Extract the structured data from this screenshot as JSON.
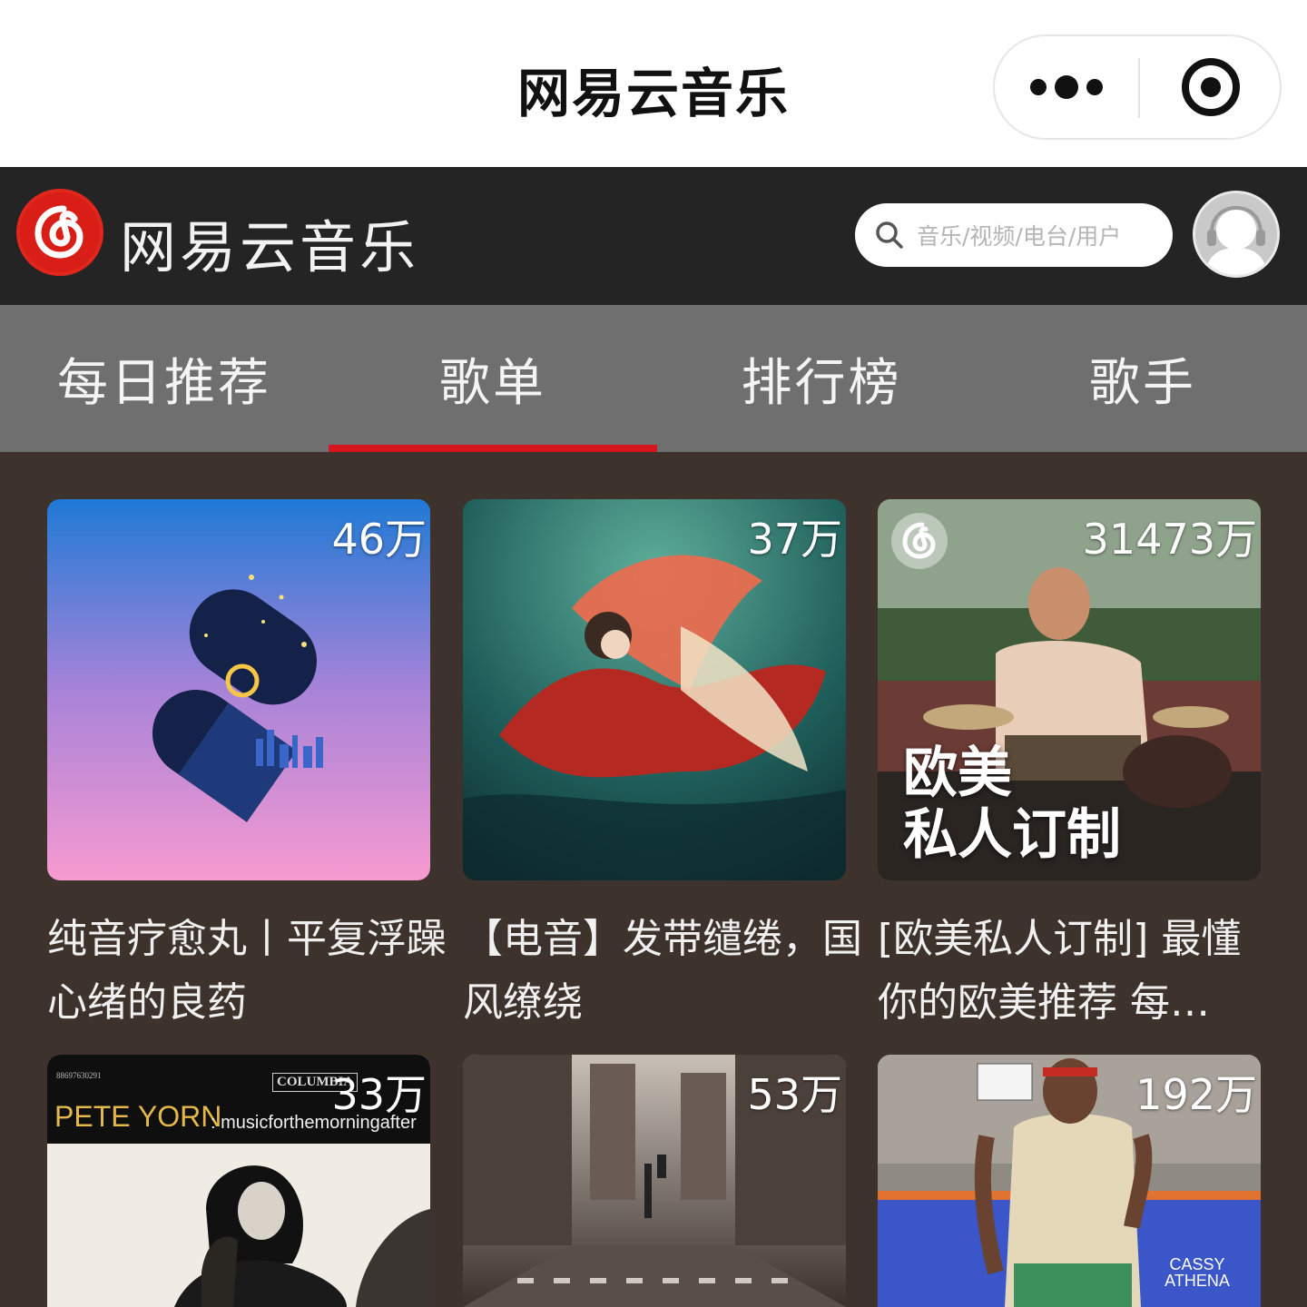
{
  "window": {
    "title": "网易云音乐",
    "more_icon": "more-dots-icon",
    "close_icon": "target-close-icon"
  },
  "header": {
    "brand": "网易云音乐",
    "logo_icon": "netease-music-logo",
    "search": {
      "placeholder": "音乐/视频/电台/用户",
      "icon": "search-icon"
    },
    "avatar_icon": "user-avatar-icon"
  },
  "tabs": [
    {
      "label": "每日推荐",
      "active": false
    },
    {
      "label": "歌单",
      "active": true
    },
    {
      "label": "排行榜",
      "active": false
    },
    {
      "label": "歌手",
      "active": false
    }
  ],
  "colors": {
    "accent": "#d5161e",
    "appbar": "#242424",
    "tabbar": "#6f6f6f",
    "content_bg": "#3e322c"
  },
  "playlists": [
    {
      "play_count": "46万",
      "title": "纯音疗愈丸丨平复浮躁心绪的良药"
    },
    {
      "play_count": "37万",
      "title": "【电音】发带缱绻，国风缭绕"
    },
    {
      "play_count": "31473万",
      "title": "[欧美私人订制] 最懂你的欧美推荐 每…",
      "cover_caption_1": "欧美",
      "cover_caption_2": "私人订制"
    },
    {
      "play_count": "33万",
      "cover_text_artist": "PETE YORN",
      "cover_text_album": ": musicforthemorningafter",
      "cover_text_label": "COLUMBIA",
      "cover_text_barcode": "88697630291"
    },
    {
      "play_count": "53万"
    },
    {
      "play_count": "192万",
      "cover_text_brand": "CASSY ATHENA"
    }
  ]
}
